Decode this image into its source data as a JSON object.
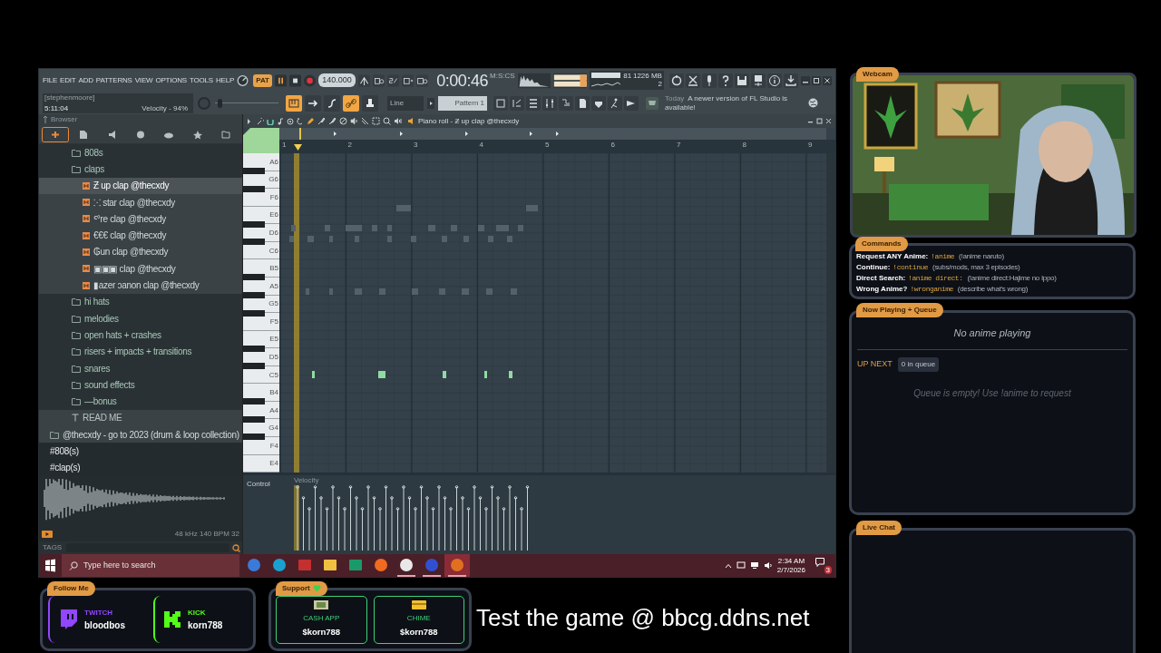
{
  "daw": {
    "menu": [
      "FILE",
      "EDIT",
      "ADD",
      "PATTERNS",
      "VIEW",
      "OPTIONS",
      "TOOLS",
      "HELP"
    ],
    "pat_label": "PAT",
    "tempo": "140.000",
    "clock": "0:00:46",
    "clock_unit": "M:S:CS",
    "cpu": "81",
    "memory": "1226 MB",
    "polyphony": "2",
    "master_pitch": {
      "level": 0.05
    },
    "hint_user": "[stephenmoore]",
    "hint_time": "5:11:04",
    "hint_value": "Velocity - 94%",
    "tool_buttons": [
      {
        "on": true
      },
      {
        "on": false
      },
      {
        "on": false
      },
      {
        "on": true
      },
      {
        "on": false
      }
    ],
    "snap": "Line",
    "pattern": "Pattern 1",
    "news_when": "Today",
    "news_text": "A newer version of FL Studio is available!"
  },
  "browser": {
    "title": "Browser",
    "items": [
      {
        "kind": "folder",
        "label": "808s",
        "selected": false
      },
      {
        "kind": "folder",
        "label": "claps",
        "selected": false,
        "children": [
          {
            "kind": "sample",
            "label": "Ƶ up clap @thecxdy",
            "selected": true
          },
          {
            "kind": "sample",
            "label": "⁙ star clap @thecxdy",
            "selected": false
          },
          {
            "kind": "sample",
            "label": "ᑦ°re clap @thecxdy",
            "selected": false
          },
          {
            "kind": "sample",
            "label": "€€€ clap @thecxdy",
            "selected": false
          },
          {
            "kind": "sample",
            "label": "₲un clap @thecxdy",
            "selected": false
          },
          {
            "kind": "sample",
            "label": "▣▣▣ clap @thecxdy",
            "selected": false
          },
          {
            "kind": "sample",
            "label": "▮azer ɔanon clap @thecxdy",
            "selected": false
          }
        ]
      },
      {
        "kind": "folder",
        "label": "hi hats",
        "selected": false
      },
      {
        "kind": "folder",
        "label": "melodies",
        "selected": false
      },
      {
        "kind": "folder",
        "label": "open hats + crashes",
        "selected": false
      },
      {
        "kind": "folder",
        "label": "risers + impacts + transitions",
        "selected": false
      },
      {
        "kind": "folder",
        "label": "snares",
        "selected": false
      },
      {
        "kind": "folder",
        "label": "sound effects",
        "selected": false
      },
      {
        "kind": "folder",
        "label": "—bonus",
        "selected": false
      },
      {
        "kind": "text",
        "label": "READ ME",
        "selected": false
      },
      {
        "kind": "root",
        "label": "@thecxdy - go to 2023 (drum & loop collection)",
        "selected": false,
        "children": [
          {
            "kind": "pack",
            "label": "#808(s)",
            "selected": false
          },
          {
            "kind": "pack",
            "label": "#clap(s)",
            "selected": false
          }
        ]
      }
    ],
    "sample_info": "48 kHz 140 BPM 32",
    "tags": "TAGS"
  },
  "piano_roll": {
    "title": "Piano roll - Ƶ up clap @thecxdy",
    "bars": [
      "1",
      "2",
      "3",
      "4",
      "5",
      "6",
      "7",
      "8",
      "9"
    ],
    "keys": [
      "A6",
      "G6",
      "F6",
      "E6",
      "D6",
      "C6",
      "B5",
      "A5",
      "G5",
      "F5",
      "E5",
      "D5",
      "C5",
      "B4",
      "A4",
      "G4",
      "F4",
      "E4"
    ],
    "control": "Control",
    "control_target": "Velocity"
  },
  "taskbar": {
    "search_placeholder": "Type here to search",
    "time": "2:34 AM",
    "date": "2/7/2026",
    "notifications": "3"
  },
  "webcam": {
    "title": "Webcam"
  },
  "commands": {
    "title": "Commands",
    "rows": [
      {
        "label": "Request ANY Anime:",
        "command": "!anime",
        "note": "(!anime naruto)"
      },
      {
        "label": "Continue:",
        "command": "!continue",
        "note": "(subs/mods, max 3 episodes)"
      },
      {
        "label": "Direct Search:",
        "command": "!anime direct:",
        "note": "(!anime direct:Hajime no Ippo)"
      },
      {
        "label": "Wrong Anime?",
        "command": "!wronganime",
        "note": "(describe what's wrong)"
      }
    ]
  },
  "now_playing": {
    "title": "Now Playing + Queue",
    "status": "No anime playing",
    "up_next": "UP NEXT",
    "queue_count": "0 in queue",
    "empty": "Queue is empty! Use !anime to request"
  },
  "live_chat": {
    "title": "Live Chat"
  },
  "follow": {
    "title": "Follow Me",
    "accounts": [
      {
        "kind": "twitch",
        "platform": "TWITCH",
        "handle": "bloodbos",
        "color": "#9146ff"
      },
      {
        "kind": "kick",
        "platform": "KICK",
        "handle": "korn788",
        "color": "#53fc18"
      }
    ]
  },
  "support": {
    "title": "Support",
    "methods": [
      {
        "kind": "cash",
        "label": "CASH APP",
        "handle": "$korn788"
      },
      {
        "kind": "card",
        "label": "CHIME",
        "handle": "$korn788"
      }
    ]
  },
  "promo": "Test the game @ bbcg.ddns.net"
}
